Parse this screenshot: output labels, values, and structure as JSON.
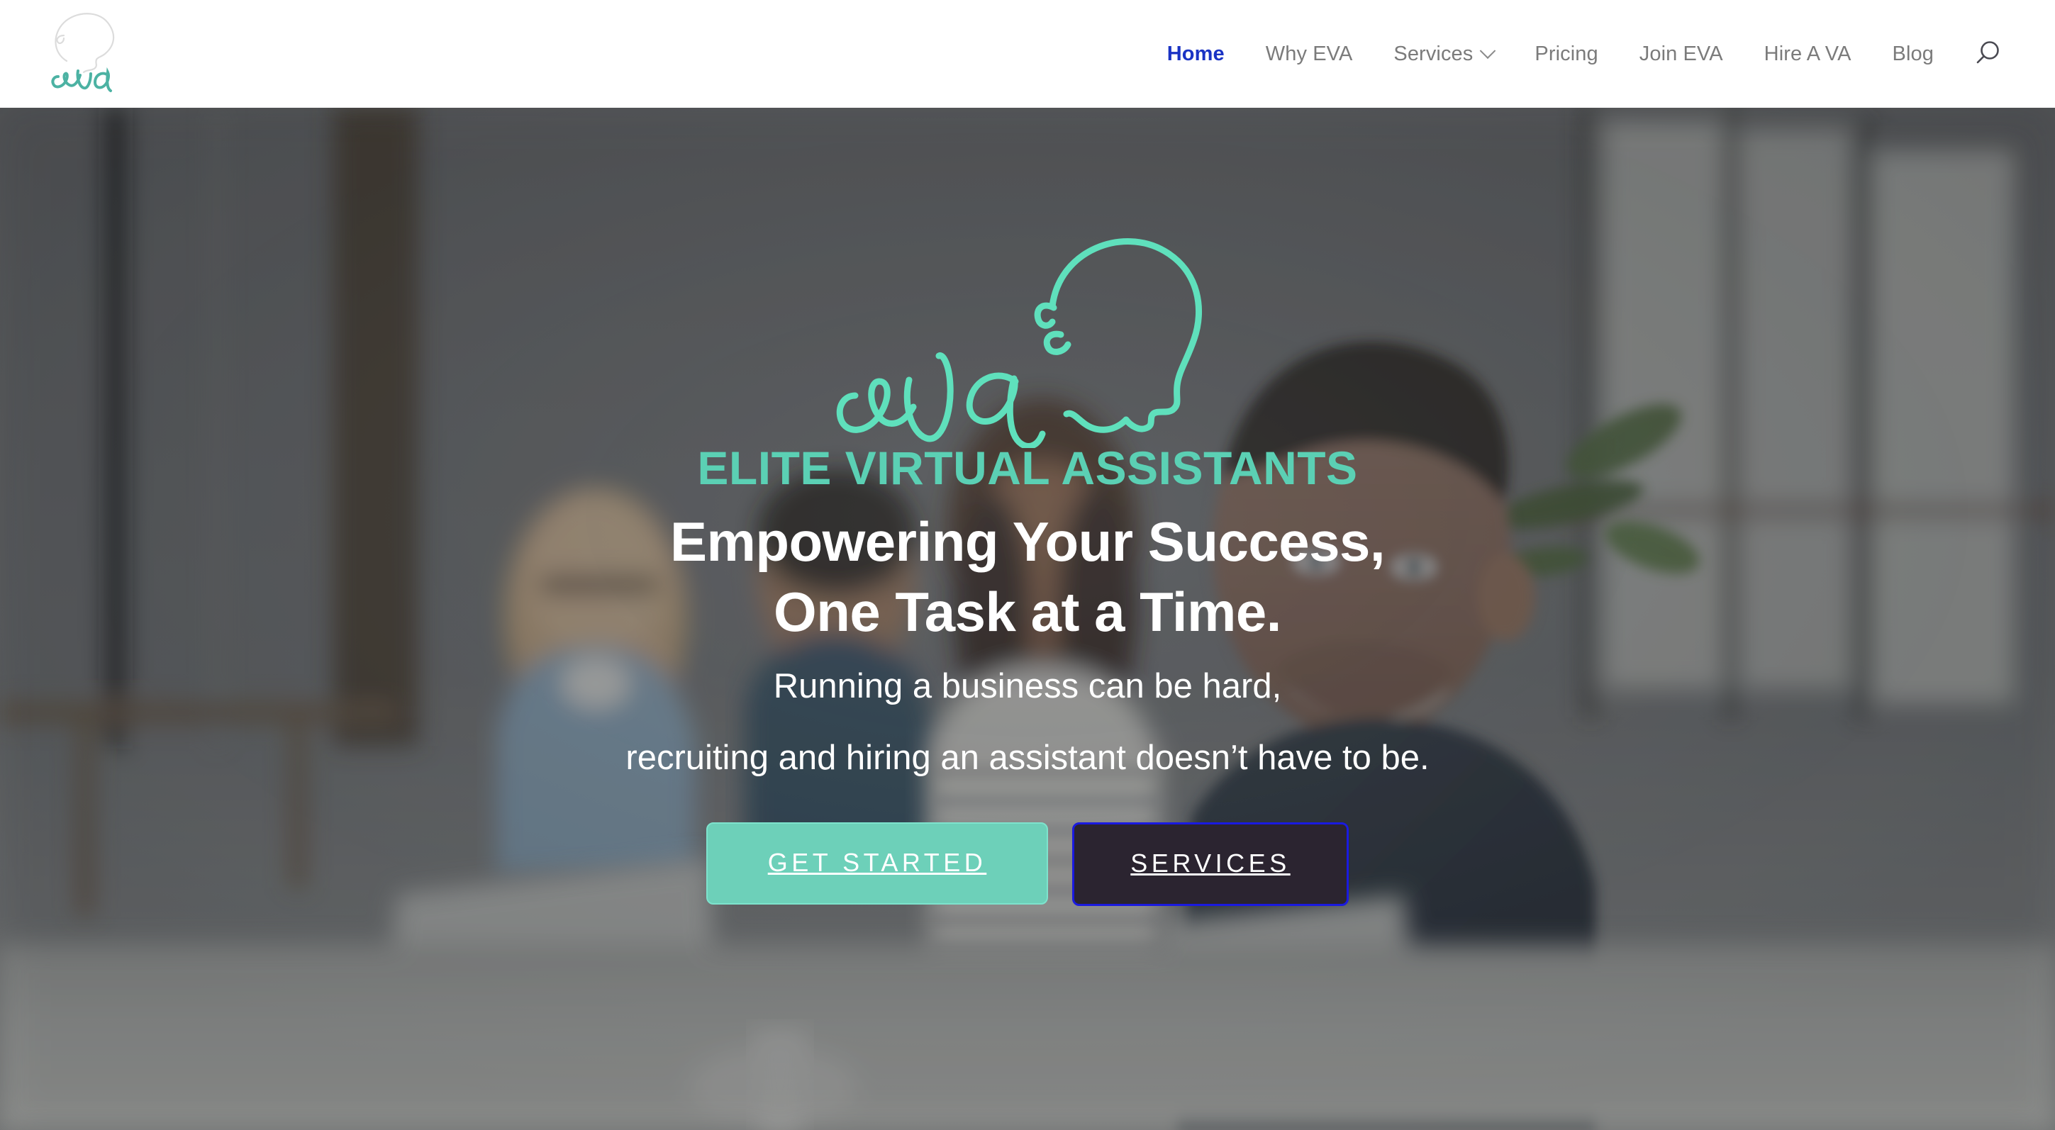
{
  "brand": {
    "logo_name": "eva-logo",
    "logo_text": "eva",
    "teal": "#4CB2A3",
    "outline_gray": "#d8d8d8"
  },
  "header": {
    "nav": [
      {
        "label": "Home",
        "name": "nav-home",
        "active": true,
        "has_caret": false
      },
      {
        "label": "Why EVA",
        "name": "nav-why-eva",
        "active": false,
        "has_caret": false
      },
      {
        "label": "Services",
        "name": "nav-services",
        "active": false,
        "has_caret": true
      },
      {
        "label": "Pricing",
        "name": "nav-pricing",
        "active": false,
        "has_caret": false
      },
      {
        "label": "Join EVA",
        "name": "nav-join-eva",
        "active": false,
        "has_caret": false
      },
      {
        "label": "Hire A VA",
        "name": "nav-hire-a-va",
        "active": false,
        "has_caret": false
      },
      {
        "label": "Blog",
        "name": "nav-blog",
        "active": false,
        "has_caret": false
      }
    ],
    "search_icon": "search-icon",
    "active_link_color": "#1a33c4",
    "link_color": "#7b7b7b"
  },
  "hero": {
    "logo_mark": "eva-head-logo",
    "logo_mark_color": "#5FE0BC",
    "eyebrow": "ELITE VIRTUAL ASSISTANTS",
    "eyebrow_color": "#5BD0B4",
    "headline_line1": "Empowering Your Success,",
    "headline_line2": "One Task at a Time.",
    "sub_line1": "Running a business can be hard,",
    "sub_line2": "recruiting and hiring an assistant doesn’t have to be.",
    "buttons": [
      {
        "label": "GET STARTED",
        "name": "get-started-button",
        "bg": "#6DD0B9",
        "fg": "#ffffff"
      },
      {
        "label": "SERVICES",
        "name": "services-button",
        "bg": "#2B2430",
        "fg": "#ffffff",
        "focus_ring": "#1a1ae0"
      }
    ],
    "background_photo": "office-team-smiling-photo",
    "overlay_color": "rgba(42,46,50,0.30)"
  }
}
